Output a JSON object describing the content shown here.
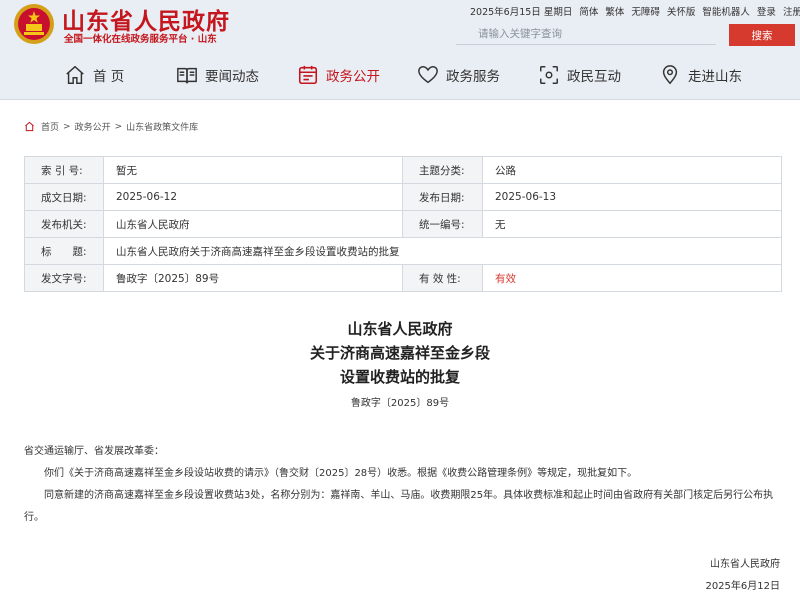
{
  "header": {
    "title": "山东省人民政府",
    "subtitle": "全国一体化在线政务服务平台 · 山东",
    "date": "2025年6月15日 星期日",
    "links": [
      "简体",
      "繁体",
      "无障碍",
      "关怀版",
      "智能机器人",
      "登录",
      "注册"
    ],
    "search_placeholder": "请输入关键字查询",
    "search_button": "搜索"
  },
  "nav": [
    {
      "label": "首 页",
      "icon": "home-icon"
    },
    {
      "label": "要闻动态",
      "icon": "news-icon"
    },
    {
      "label": "政务公开",
      "icon": "open-gov-icon",
      "active": true
    },
    {
      "label": "政务服务",
      "icon": "heart-service-icon"
    },
    {
      "label": "政民互动",
      "icon": "interaction-icon"
    },
    {
      "label": "走进山东",
      "icon": "location-icon"
    }
  ],
  "breadcrumb": [
    "首页",
    "政务公开",
    "山东省政策文件库"
  ],
  "meta": {
    "index_label": "索 引 号:",
    "index_value": "暂无",
    "category_label": "主题分类:",
    "category_value": "公路",
    "created_label": "成文日期:",
    "created_value": "2025-06-12",
    "published_label": "发布日期:",
    "published_value": "2025-06-13",
    "issuer_label": "发布机关:",
    "issuer_value": "山东省人民政府",
    "code_label": "统一编号:",
    "code_value": "无",
    "title_label": "标　　题:",
    "title_value": "山东省人民政府关于济商高速嘉祥至金乡段设置收费站的批复",
    "docno_label": "发文字号:",
    "docno_value": "鲁政字〔2025〕89号",
    "validity_label": "有 效 性:",
    "validity_value": "有效",
    "validity_color": "#d63a2f"
  },
  "doc": {
    "title_line1": "山东省人民政府",
    "title_line2": "关于济商高速嘉祥至金乡段",
    "title_line3": "设置收费站的批复",
    "number": "鲁政字〔2025〕89号",
    "addressee": "省交通运输厅、省发展改革委：",
    "para1": "你们《关于济商高速嘉祥至金乡段设站收费的请示》（鲁交财〔2025〕28号）收悉。根据《收费公路管理条例》等规定，现批复如下。",
    "para2": "同意新建的济商高速嘉祥至金乡段设置收费站3处，名称分别为：嘉祥南、羊山、马庙。收费期限25年。具体收费标准和起止时间由省政府有关部门核定后另行公布执行。",
    "sign_org": "山东省人民政府",
    "sign_date": "2025年6月12日"
  },
  "colors": {
    "brand_red": "#c4161c",
    "button_red": "#d63a2f",
    "header_bg": "#e9eef4"
  }
}
